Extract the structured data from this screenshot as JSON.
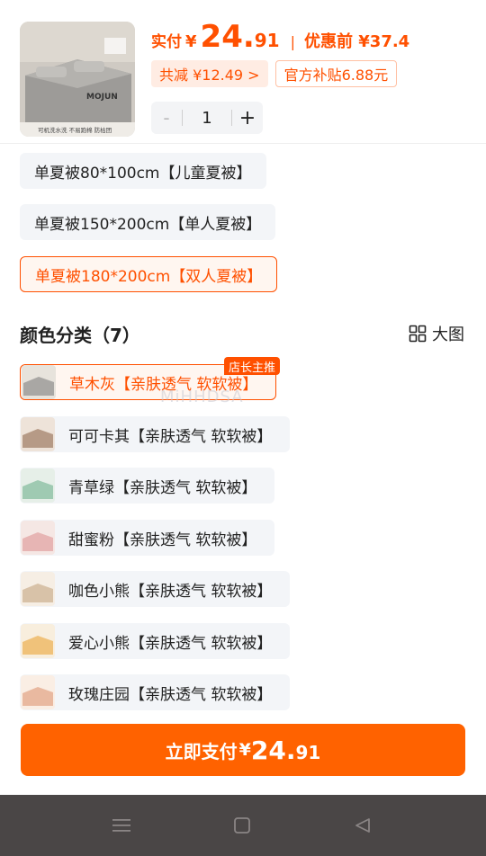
{
  "header": {
    "thumb_brand": "MOJUN",
    "thumb_caption": "可机洗水洗 不易跑棉 防枯团",
    "price_label": "实付",
    "currency": "¥",
    "price_int": "24.",
    "price_dec": "91",
    "separator": "|",
    "orig_price_text": "优惠前 ¥37.4",
    "discount_text": "共减 ¥12.49 >",
    "subsidy_text": "官方补贴6.88元",
    "quantity": {
      "minus": "-",
      "value": "1",
      "plus": "+"
    }
  },
  "sizes": [
    {
      "label": "单夏被80*100cm【儿童夏被】",
      "selected": false
    },
    {
      "label": "单夏被150*200cm【单人夏被】",
      "selected": false
    },
    {
      "label": "单夏被180*200cm【双人夏被】",
      "selected": true
    }
  ],
  "colors_section": {
    "title": "颜色分类（7）",
    "big_view_label": "大图",
    "featured_tag": "店长主推",
    "watermark": "MiHHDSA",
    "items": [
      {
        "label": "草木灰【亲肤透气 软软被】",
        "selected": true,
        "swatch": "#a9a7a4",
        "swatch2": "#e7e3dc"
      },
      {
        "label": "可可卡其【亲肤透气 软软被】",
        "selected": false,
        "swatch": "#b69a86",
        "swatch2": "#eee3d9"
      },
      {
        "label": "青草绿【亲肤透气 软软被】",
        "selected": false,
        "swatch": "#9fcab2",
        "swatch2": "#e6efe8"
      },
      {
        "label": "甜蜜粉【亲肤透气 软软被】",
        "selected": false,
        "swatch": "#e7b5b4",
        "swatch2": "#f5e7e4"
      },
      {
        "label": "咖色小熊【亲肤透气 软软被】",
        "selected": false,
        "swatch": "#d8c2a8",
        "swatch2": "#f6eee4"
      },
      {
        "label": "爱心小熊【亲肤透气 软软被】",
        "selected": false,
        "swatch": "#f0c27a",
        "swatch2": "#f8eedd"
      },
      {
        "label": "玫瑰庄园【亲肤透气 软软被】",
        "selected": false,
        "swatch": "#e9b9a0",
        "swatch2": "#faeee4"
      }
    ]
  },
  "pay_button": {
    "label": "立即支付",
    "currency": "¥",
    "int": "24.",
    "dec": "91"
  },
  "colors": {
    "accent": "#ff5000",
    "button": "#ff6200",
    "navbar": "#4a4646"
  },
  "nav_icons": [
    "menu-icon",
    "home-square-icon",
    "back-triangle-icon"
  ]
}
